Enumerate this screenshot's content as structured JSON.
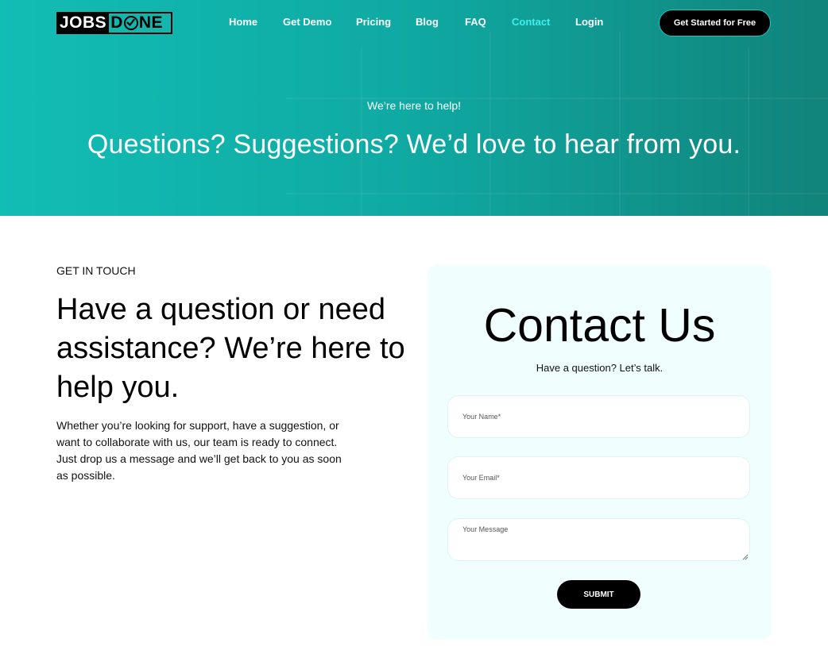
{
  "brand": {
    "logo_left": "JOBS",
    "logo_right_pre": "D",
    "logo_right_post": "NE"
  },
  "nav": {
    "items": [
      {
        "label": "Home",
        "active": false
      },
      {
        "label": "Get Demo",
        "active": false
      },
      {
        "label": "Pricing",
        "active": false
      },
      {
        "label": "Blog",
        "active": false
      },
      {
        "label": "FAQ",
        "active": false
      },
      {
        "label": "Contact",
        "active": true
      },
      {
        "label": "Login",
        "active": false
      }
    ],
    "cta_label": "Get Started for Free"
  },
  "hero": {
    "tagline": "We’re here to help!",
    "heading": "Questions? Suggestions? We’d love to hear from you."
  },
  "intro": {
    "eyebrow": "GET IN TOUCH",
    "headline": "Have a question or need assistance? We’re here to help you.",
    "body": "Whether you’re looking for support, have a suggestion, or want to collaborate with us, our team is ready to connect. Just drop us a message and we’ll get back to you as soon as possible."
  },
  "contact_form": {
    "title": "Contact Us",
    "subtitle": "Have a question? Let’s talk.",
    "name_placeholder": "Your Name*",
    "email_placeholder": "Your Email*",
    "message_placeholder": "Your Message",
    "submit_label": "SUBMIT"
  },
  "colors": {
    "hero_start": "#12bdb4",
    "hero_end": "#11837a",
    "nav_active": "#3ef0ea",
    "card_bg": "#f1fefe",
    "button_bg": "#000000"
  }
}
